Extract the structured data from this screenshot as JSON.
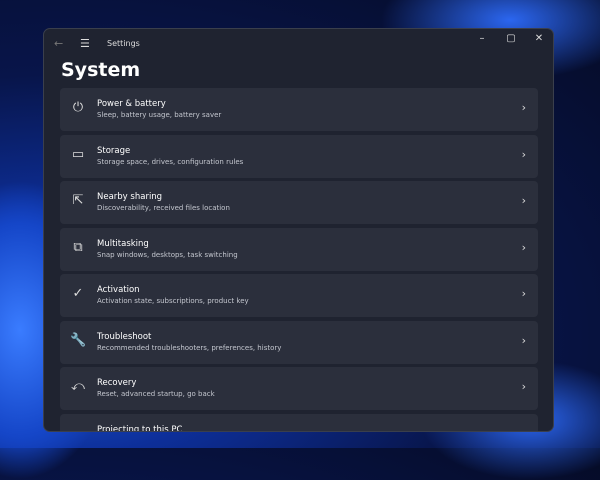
{
  "window": {
    "title": "Settings",
    "page_title": "System"
  },
  "items": [
    {
      "title": "Power & battery",
      "subtitle": "Sleep, battery usage, battery saver",
      "icon": "power-icon",
      "glyph": "⏻"
    },
    {
      "title": "Storage",
      "subtitle": "Storage space, drives, configuration rules",
      "icon": "storage-icon",
      "glyph": "▭"
    },
    {
      "title": "Nearby sharing",
      "subtitle": "Discoverability, received files location",
      "icon": "share-icon",
      "glyph": "⇱"
    },
    {
      "title": "Multitasking",
      "subtitle": "Snap windows, desktops, task switching",
      "icon": "multitasking-icon",
      "glyph": "⧉"
    },
    {
      "title": "Activation",
      "subtitle": "Activation state, subscriptions, product key",
      "icon": "check-circle-icon",
      "glyph": "✓"
    },
    {
      "title": "Troubleshoot",
      "subtitle": "Recommended troubleshooters, preferences, history",
      "icon": "wrench-icon",
      "glyph": "🔧"
    },
    {
      "title": "Recovery",
      "subtitle": "Reset, advanced startup, go back",
      "icon": "recovery-icon",
      "glyph": "⤺"
    },
    {
      "title": "Projecting to this PC",
      "subtitle": "",
      "icon": "projecting-icon",
      "glyph": "▭"
    }
  ]
}
